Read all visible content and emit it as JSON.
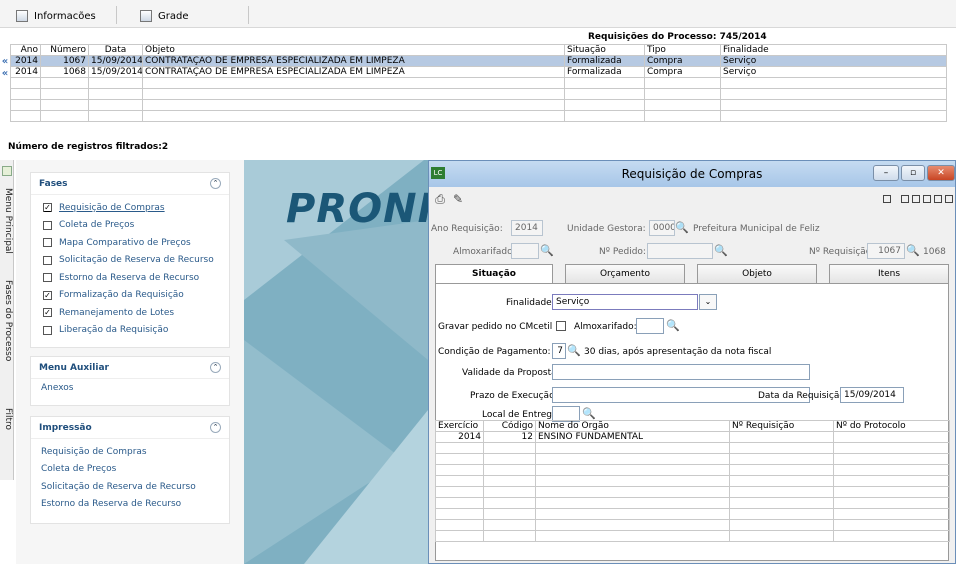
{
  "topbar": {
    "tabs": [
      {
        "label": "Informacões",
        "icon": "form-icon"
      },
      {
        "label": "Grade",
        "icon": "grid-icon"
      }
    ]
  },
  "requisicoes": {
    "title": "Requisições do Processo: 745/2014",
    "columns": [
      "Ano",
      "Número",
      "Data",
      "Objeto",
      "Situação",
      "Tipo",
      "Finalidade"
    ],
    "rows": [
      {
        "ano": "2014",
        "numero": "1067",
        "data": "15/09/2014",
        "objeto": "CONTRATAÇÃO DE EMPRESA ESPECIALIZADA EM LIMPEZA",
        "situacao": "Formalizada",
        "tipo": "Compra",
        "finalidade": "Serviço"
      },
      {
        "ano": "2014",
        "numero": "1068",
        "data": "15/09/2014",
        "objeto": "CONTRATAÇÃO DE EMPRESA ESPECIALIZADA EM LIMPEZA",
        "situacao": "Formalizada",
        "tipo": "Compra",
        "finalidade": "Serviço"
      }
    ],
    "row_marker": "«",
    "filtered_count": "Número de registros filtrados:2"
  },
  "vertical_tabs": [
    "Menu Principal",
    "Fases do Processo",
    "Filtro"
  ],
  "sidebar": {
    "fases": {
      "title": "Fases",
      "items": [
        {
          "label": "Requisição de Compras",
          "checked": true
        },
        {
          "label": "Coleta de Preços",
          "checked": false
        },
        {
          "label": "Mapa Comparativo de Preços",
          "checked": false
        },
        {
          "label": "Solicitação de Reserva de Recurso",
          "checked": false
        },
        {
          "label": "Estorno da Reserva de Recurso",
          "checked": false
        },
        {
          "label": "Formalização da Requisição",
          "checked": true
        },
        {
          "label": "Remanejamento de Lotes",
          "checked": true
        },
        {
          "label": "Liberação da Requisição",
          "checked": false
        }
      ]
    },
    "menu_auxiliar": {
      "title": "Menu Auxiliar",
      "items": [
        "Anexos"
      ]
    },
    "impressao": {
      "title": "Impressão",
      "items": [
        "Requisição de Compras",
        "Coleta de Preços",
        "Solicitação de Reserva de Recurso",
        "Estorno da Reserva de Recurso"
      ]
    }
  },
  "brand": {
    "text": "PRONIM"
  },
  "dialog": {
    "app_badge": "LC",
    "title": "Requisição de Compras",
    "fields": {
      "ano_requisicao_label": "Ano Requisição:",
      "ano_requisicao": "2014",
      "unidade_gestora_label": "Unidade Gestora:",
      "unidade_gestora": "0000",
      "unidade_gestora_nome": "Prefeitura Municipal de Feliz",
      "almoxarifado_label": "Almoxarifado:",
      "almoxarifado": "",
      "pedido_label": "Nº Pedido:",
      "pedido": "",
      "num_requisicao_label": "Nº Requisição:",
      "num_requisicao": "1067",
      "num_requisicao_ate": "1068"
    },
    "tabs": [
      "Situação",
      "Orçamento",
      "Objeto",
      "Itens"
    ],
    "situacao": {
      "finalidade_label": "Finalidade:",
      "finalidade": "Serviço",
      "gravar_label": "Gravar pedido no CMcetil",
      "almox_label": "Almoxarifado:",
      "almox": "",
      "condicao_label": "Condição de Pagamento:",
      "condicao_codigo": "7",
      "condicao_desc": "30 dias, após apresentação da nota fiscal",
      "validade_label": "Validade da Proposta:",
      "validade": "",
      "prazo_label": "Prazo de Execução:",
      "prazo": "",
      "data_req_label": "Data da Requisição:",
      "data_req": "15/09/2014",
      "local_label": "Local de Entrega:",
      "local": ""
    },
    "orgaos": {
      "columns": [
        "Exercício",
        "Código",
        "Nome do Órgão",
        "Nº Requisição",
        "Nº do Protocolo"
      ],
      "rows": [
        {
          "exercicio": "2014",
          "codigo": "12",
          "nome": "ENSINO FUNDAMENTAL",
          "requisicao": "",
          "protocolo": ""
        }
      ]
    }
  }
}
